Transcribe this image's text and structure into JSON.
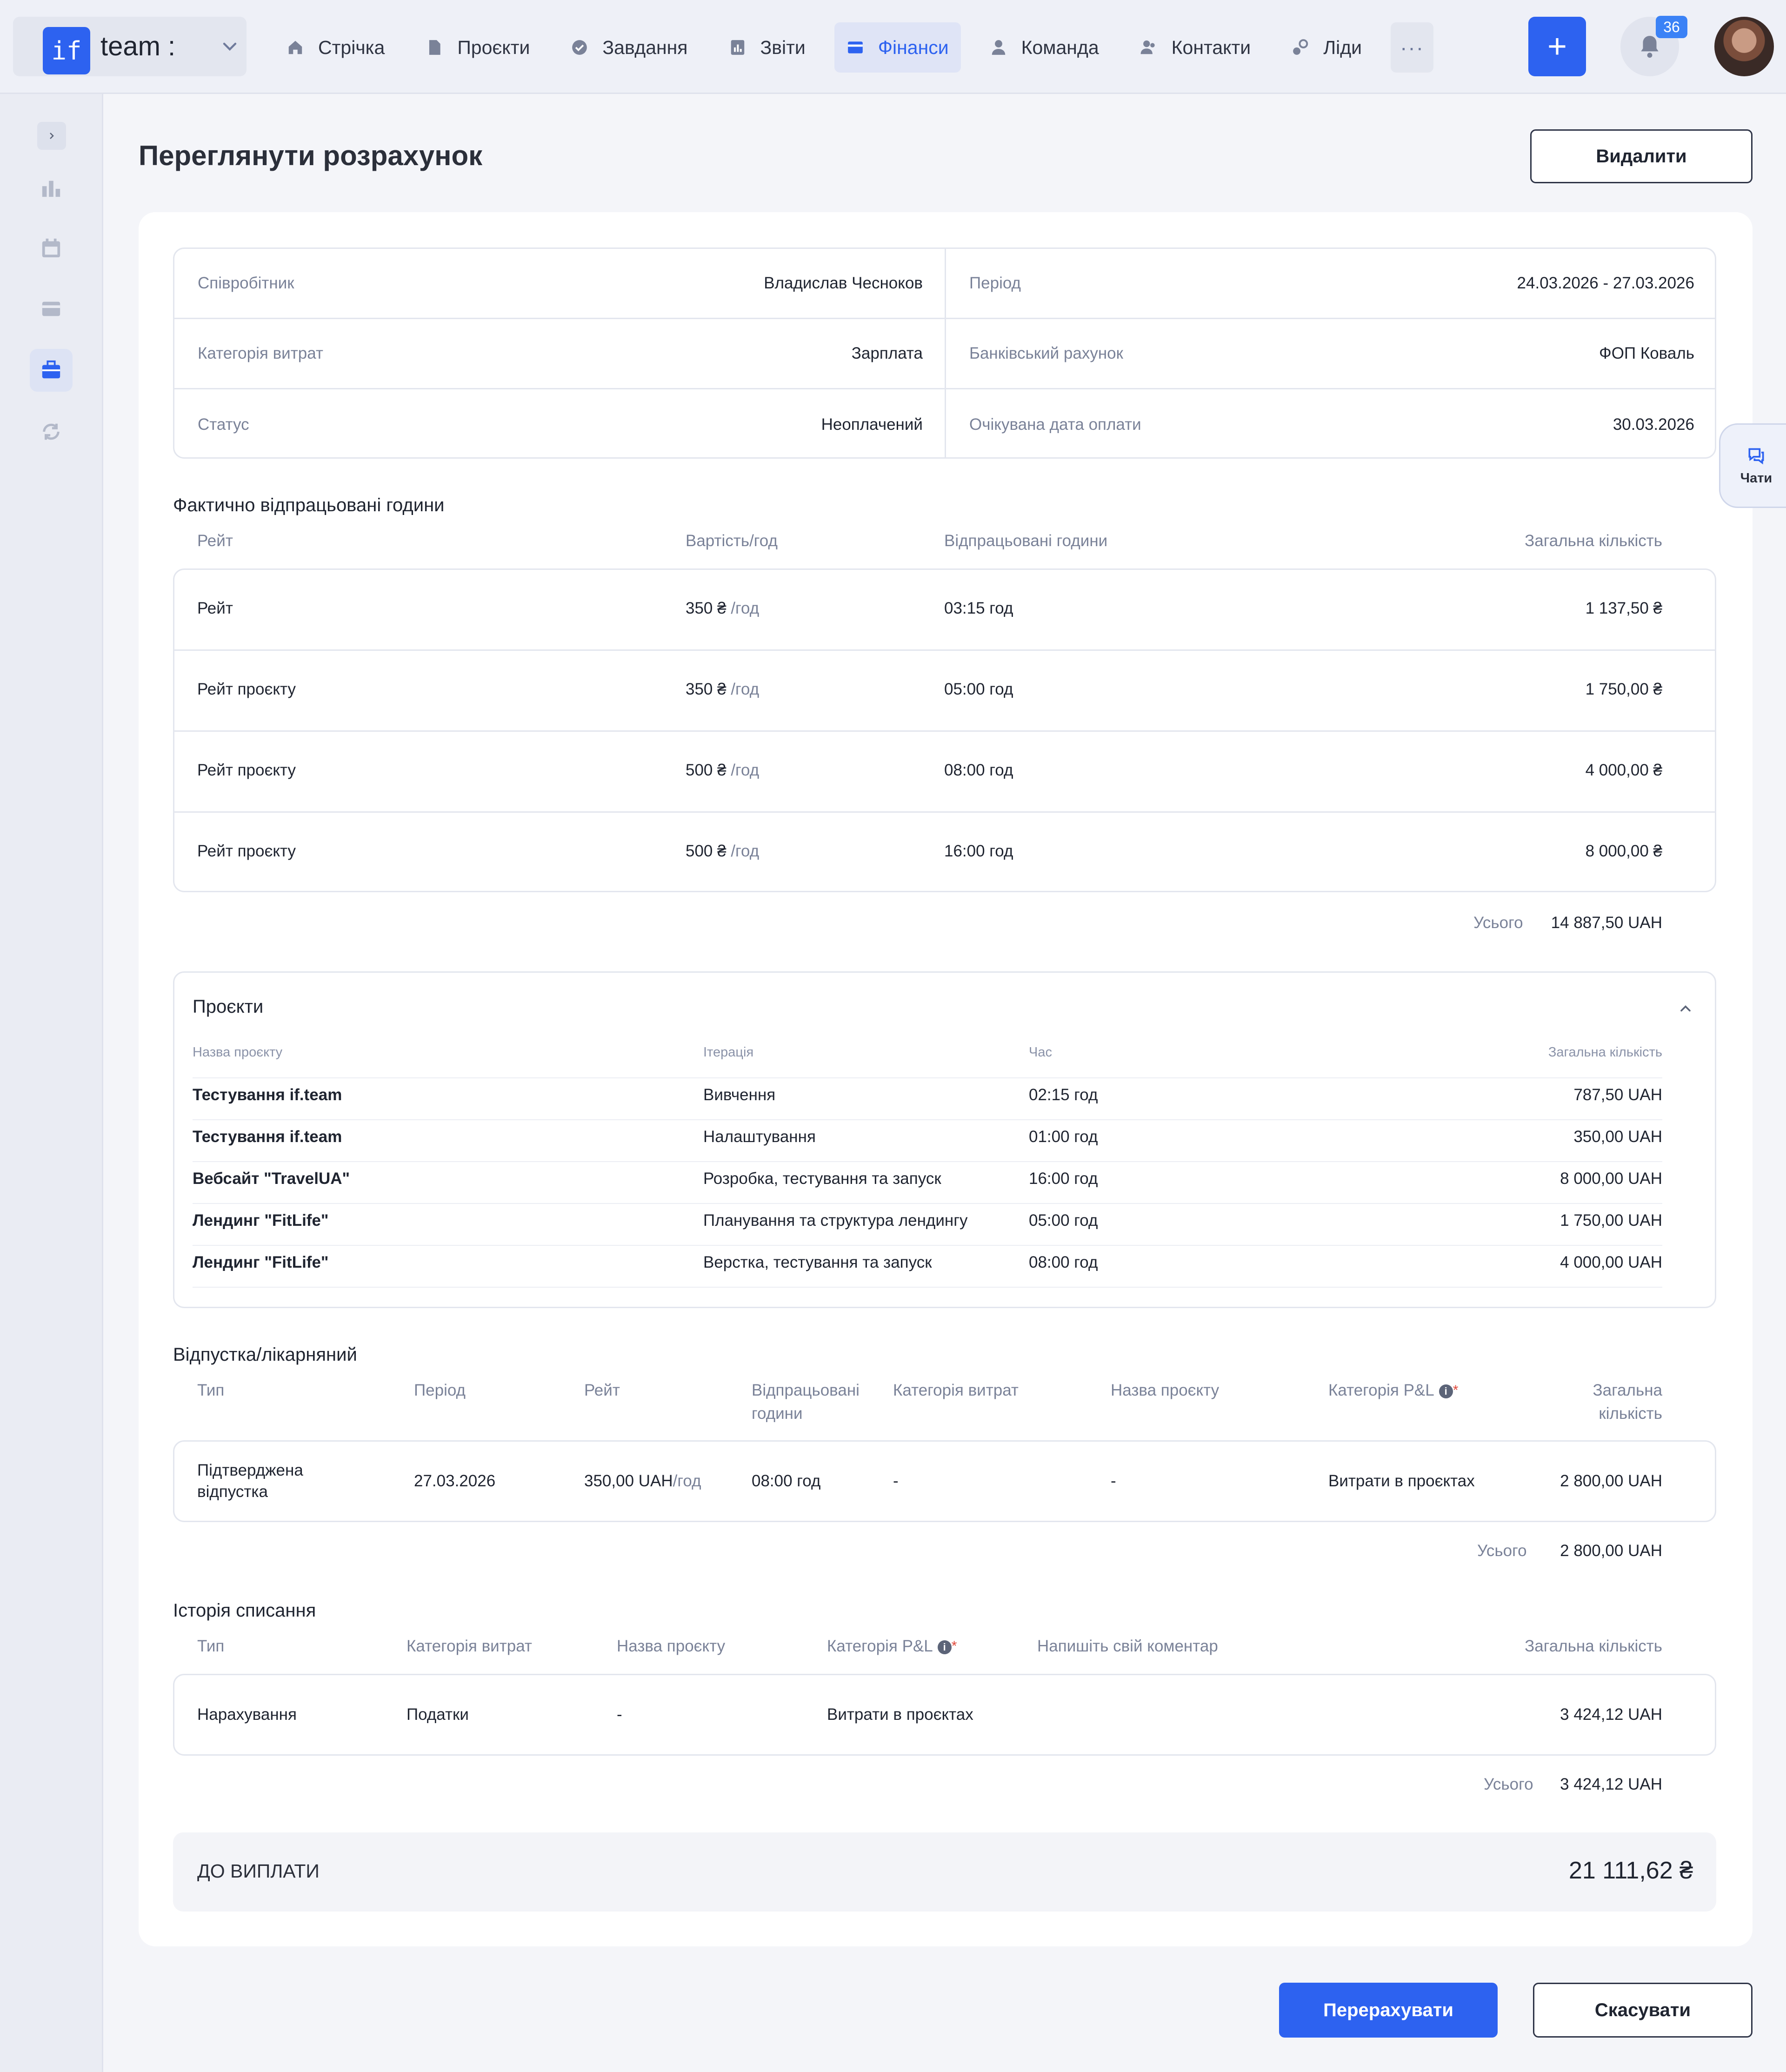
{
  "app": {
    "logo_text": "if",
    "name": "team :"
  },
  "nav": {
    "items": [
      {
        "label": "Стрічка",
        "icon": "home-icon"
      },
      {
        "label": "Проєкти",
        "icon": "file-icon"
      },
      {
        "label": "Завдання",
        "icon": "check-circle-icon"
      },
      {
        "label": "Звіти",
        "icon": "report-icon"
      },
      {
        "label": "Фінанси",
        "icon": "wallet-icon",
        "active": true
      },
      {
        "label": "Команда",
        "icon": "user-icon"
      },
      {
        "label": "Контакти",
        "icon": "contacts-icon"
      },
      {
        "label": "Ліди",
        "icon": "leads-icon"
      }
    ],
    "more_label": "···",
    "add_label": "+",
    "notifications_count": "36"
  },
  "page": {
    "title": "Переглянути розрахунок",
    "delete_label": "Видалити",
    "recalc_label": "Перерахувати",
    "cancel_label": "Скасувати"
  },
  "info": {
    "employee_label": "Співробітник",
    "employee": "Владислав Чесноков",
    "period_label": "Період",
    "period": "24.03.2026 - 27.03.2026",
    "category_label": "Категорія витрат",
    "category": "Зарплата",
    "bank_label": "Банківський рахунок",
    "bank": "ФОП Коваль",
    "status_label": "Статус",
    "status": "Неоплачений",
    "due_label": "Очікувана дата оплати",
    "due": "30.03.2026"
  },
  "hours": {
    "title": "Фактично відпрацьовані години",
    "headers": {
      "rate": "Рейт",
      "cost": "Вартість/год",
      "hours": "Відпрацьовані години",
      "total": "Загальна кількість"
    },
    "rows": [
      {
        "rate": "Рейт",
        "cost": "350 ₴",
        "unit": "/год",
        "hours": "03:15 год",
        "total": "1 137,50 ₴"
      },
      {
        "rate": "Рейт проєкту",
        "cost": "350 ₴",
        "unit": "/год",
        "hours": "05:00 год",
        "total": "1 750,00 ₴"
      },
      {
        "rate": "Рейт проєкту",
        "cost": "500 ₴",
        "unit": "/год",
        "hours": "08:00 год",
        "total": "4 000,00 ₴"
      },
      {
        "rate": "Рейт проєкту",
        "cost": "500 ₴",
        "unit": "/год",
        "hours": "16:00 год",
        "total": "8 000,00 ₴"
      }
    ],
    "total_label": "Усього",
    "total": "14 887,50 UAH"
  },
  "projects": {
    "title": "Проєкти",
    "headers": {
      "name": "Назва проєкту",
      "iteration": "Ітерація",
      "time": "Час",
      "total": "Загальна кількість"
    },
    "rows": [
      {
        "name": "Тестування if.team",
        "iteration": "Вивчення",
        "time": "02:15 год",
        "total": "787,50 UAH"
      },
      {
        "name": "Тестування if.team",
        "iteration": "Налаштування",
        "time": "01:00 год",
        "total": "350,00 UAH"
      },
      {
        "name": "Вебсайт \"TravelUA\"",
        "iteration": "Розробка, тестування та запуск",
        "time": "16:00 год",
        "total": "8 000,00 UAH"
      },
      {
        "name": "Лендинг \"FitLife\"",
        "iteration": "Планування та структура лендингу",
        "time": "05:00 год",
        "total": "1 750,00 UAH"
      },
      {
        "name": "Лендинг \"FitLife\"",
        "iteration": "Верстка, тестування та запуск",
        "time": "08:00 год",
        "total": "4 000,00 UAH"
      }
    ]
  },
  "leave": {
    "title": "Відпустка/лікарняний",
    "headers": {
      "type": "Тип",
      "period": "Період",
      "rate": "Рейт",
      "hours_1": "Відпрацьовані",
      "hours_2": "години",
      "category": "Категорія витрат",
      "project": "Назва проєкту",
      "pl": "Категорія P&L",
      "total_1": "Загальна",
      "total_2": "кількість"
    },
    "row": {
      "type_1": "Підтверджена",
      "type_2": "відпустка",
      "period": "27.03.2026",
      "rate": "350,00 UAH",
      "rate_unit": "/год",
      "hours": "08:00 год",
      "category": "-",
      "project": "-",
      "pl": "Витрати в проєктах",
      "total": "2 800,00 UAH"
    },
    "total_label": "Усього",
    "total": "2 800,00 UAH"
  },
  "writeoff": {
    "title": "Історія списання",
    "headers": {
      "type": "Тип",
      "category": "Категорія витрат",
      "project": "Назва проєкту",
      "pl": "Категорія P&L",
      "comment": "Напишіть свій коментар",
      "total": "Загальна кількість"
    },
    "row": {
      "type": "Нарахування",
      "category": "Податки",
      "project": "-",
      "pl": "Витрати в проєктах",
      "comment": "",
      "total": "3 424,12 UAH"
    },
    "total_label": "Усього",
    "total": "3 424,12 UAH"
  },
  "payout": {
    "label": "ДО ВИПЛАТИ",
    "value": "21 111,62 ₴"
  },
  "chats": {
    "label": "Чати"
  },
  "colors": {
    "accent": "#2d62f0",
    "background": "#f4f5f9",
    "card": "#ffffff",
    "muted_text": "#7a8298"
  }
}
